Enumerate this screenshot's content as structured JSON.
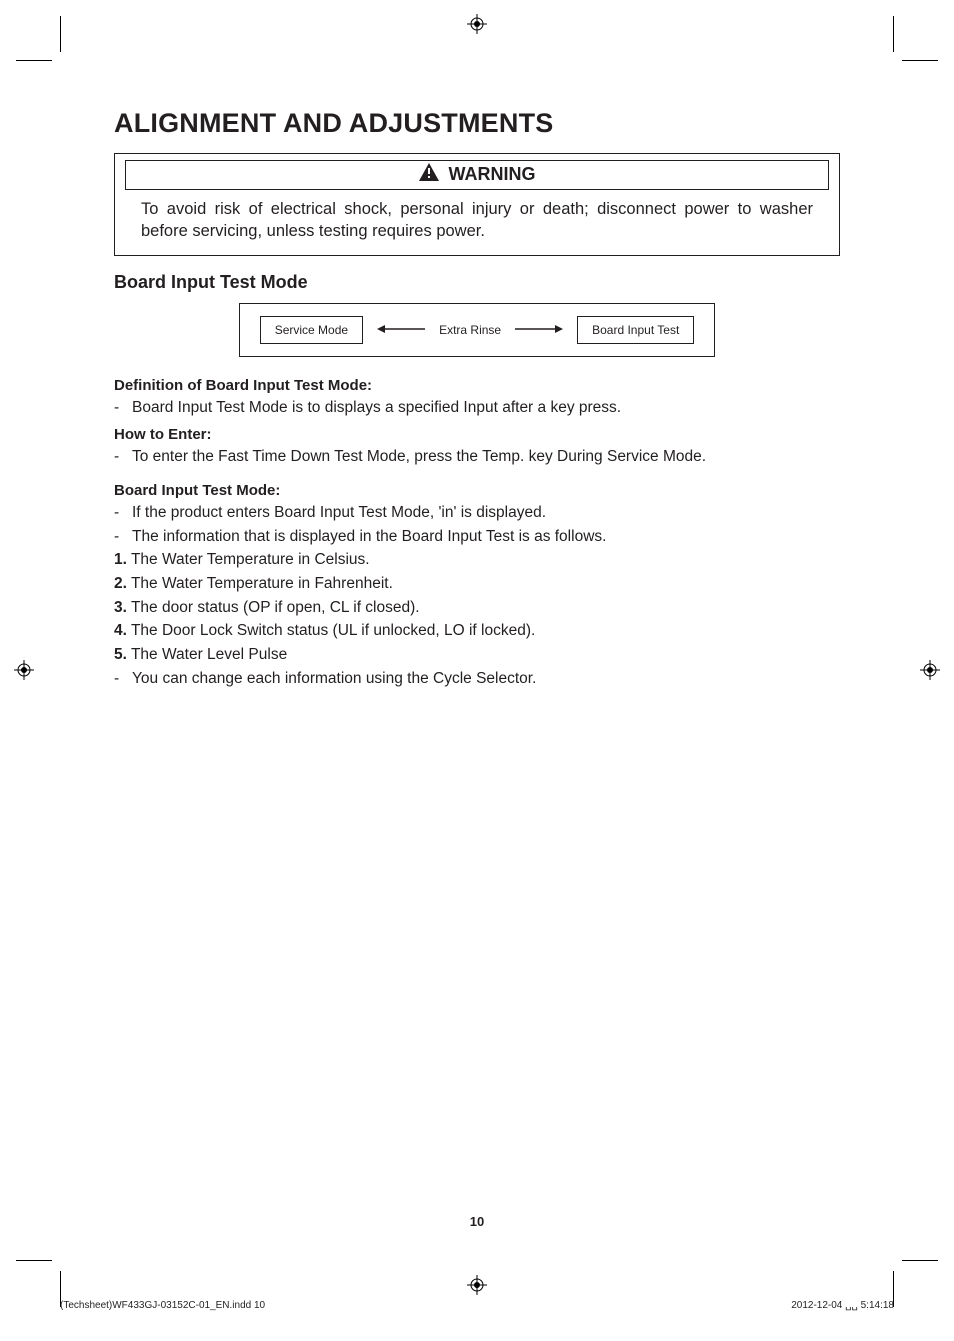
{
  "title": "ALIGNMENT AND ADJUSTMENTS",
  "warning": {
    "label": "WARNING",
    "text": "To avoid risk of electrical shock, personal injury or death; disconnect power to washer before servicing, unless testing requires power."
  },
  "section_title": "Board Input Test Mode",
  "flow": {
    "left_box": "Service Mode",
    "center_label": "Extra Rinse",
    "right_box": "Board Input Test"
  },
  "definition": {
    "heading": "Definition of Board Input Test Mode:",
    "line": "Board Input Test Mode is to displays a specified Input after a key press."
  },
  "enter": {
    "heading": "How to Enter:",
    "line": "To enter the Fast Time Down Test Mode, press the Temp. key During Service Mode."
  },
  "mode": {
    "heading": "Board Input Test Mode:",
    "lines": [
      "If the product enters Board Input Test Mode, 'in' is displayed.",
      "The information that is displayed in the Board Input Test is as follows."
    ],
    "numbered": [
      "The Water Temperature in Celsius.",
      "The Water Temperature in Fahrenheit.",
      "The door status (OP if open, CL if closed).",
      "The Door Lock Switch status (UL if unlocked, LO if locked).",
      "The Water Level Pulse"
    ],
    "tail": "You can change each information using the Cycle Selector."
  },
  "page_number": "10",
  "footer": {
    "left": "(Techsheet)WF433GJ-03152C-01_EN.indd   10",
    "right": "2012-12-04   ␣␣ 5:14:18"
  }
}
